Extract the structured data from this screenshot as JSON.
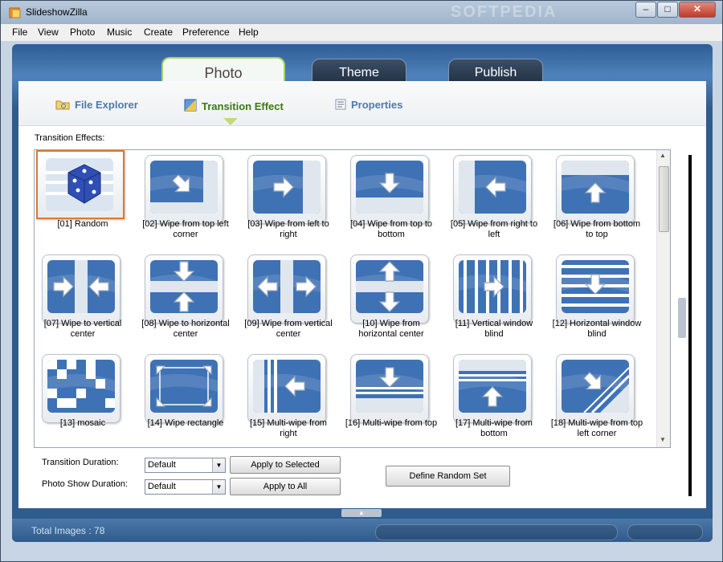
{
  "window": {
    "title": "SlideshowZilla",
    "watermark": "SOFTPEDIA"
  },
  "menu": [
    "File",
    "View",
    "Photo",
    "Music",
    "Create",
    "Preference",
    "Help"
  ],
  "main_tabs": [
    {
      "label": "Photo",
      "active": true
    },
    {
      "label": "Theme",
      "active": false
    },
    {
      "label": "Publish",
      "active": false
    }
  ],
  "sub_tabs": [
    {
      "label": "File Explorer",
      "icon": "folder-icon",
      "active": false
    },
    {
      "label": "Transition Effect",
      "icon": "transition-icon",
      "active": true
    },
    {
      "label": "Properties",
      "icon": "properties-icon",
      "active": false
    }
  ],
  "effects_label": "Transition Effects:",
  "effects": [
    {
      "label": "[01] Random",
      "icon": "dice-icon",
      "selected": true
    },
    {
      "label": "[02] Wipe from top left corner",
      "icon": "arrow-down-right-icon"
    },
    {
      "label": "[03] Wipe from left to right",
      "icon": "arrow-right-icon"
    },
    {
      "label": "[04] Wipe from top to bottom",
      "icon": "arrow-down-icon"
    },
    {
      "label": "[05] Wipe from right to left",
      "icon": "arrow-left-icon"
    },
    {
      "label": "[06] Wipe from bottom to top",
      "icon": "arrow-up-icon"
    },
    {
      "label": "[07] Wipe to vertical center",
      "icon": "arrows-to-vertical-center-icon"
    },
    {
      "label": "[08] Wipe to horizontal center",
      "icon": "arrows-to-horizontal-center-icon"
    },
    {
      "label": "[09] Wipe from vertical center",
      "icon": "arrows-from-vertical-center-icon"
    },
    {
      "label": "[10] Wipe from horizontal center",
      "icon": "arrows-from-horizontal-center-icon"
    },
    {
      "label": "[11] Vertical window blind",
      "icon": "vertical-blind-icon"
    },
    {
      "label": "[12] Horizontal window blind",
      "icon": "horizontal-blind-icon"
    },
    {
      "label": "[13] mosaic",
      "icon": "mosaic-icon"
    },
    {
      "label": "[14] Wipe rectangle",
      "icon": "wipe-rectangle-icon"
    },
    {
      "label": "[15] Multi-wipe from right",
      "icon": "multi-wipe-right-icon"
    },
    {
      "label": "[16] Multi-wipe from top",
      "icon": "multi-wipe-top-icon"
    },
    {
      "label": "[17] Multi-wipe from bottom",
      "icon": "multi-wipe-bottom-icon"
    },
    {
      "label": "[18] Multi-wipe from top left corner",
      "icon": "multi-wipe-top-left-icon"
    }
  ],
  "form": {
    "transition_duration_label": "Transition Duration:",
    "transition_duration_value": "Default",
    "photo_show_duration_label": "Photo Show Duration:",
    "photo_show_duration_value": "Default",
    "apply_selected": "Apply to Selected",
    "apply_all": "Apply to All",
    "define_random": "Define Random Set"
  },
  "status": {
    "total_images": "Total Images : 78"
  },
  "colors": {
    "accent": "#e0772b",
    "tile_blue": "#3f72b5",
    "active_tab_green": "#3c7a12"
  }
}
